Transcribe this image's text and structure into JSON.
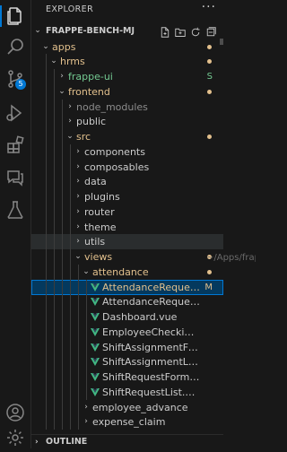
{
  "explorer": {
    "title": "EXPLORER",
    "more": "···",
    "workspace": "FRAPPE-BENCH-MJ",
    "tooltip_fragment": "~/Apps/frap"
  },
  "activity_bar": {
    "items": [
      {
        "name": "files",
        "active": true
      },
      {
        "name": "search"
      },
      {
        "name": "source-control",
        "badge": "5"
      },
      {
        "name": "run-debug"
      },
      {
        "name": "extensions"
      },
      {
        "name": "chat"
      },
      {
        "name": "testing"
      }
    ],
    "bottom": [
      "account",
      "manage"
    ]
  },
  "colors": {
    "folder_text": "#cccccc",
    "modified": "#e2c08d",
    "vue_green": "#41b883",
    "selection": "#04395e",
    "submodule": "#73c991"
  },
  "tree": [
    {
      "label": "apps",
      "depth": 1,
      "type": "folder",
      "open": true,
      "color": "#e2c08d",
      "dot": true
    },
    {
      "label": "hrms",
      "depth": 2,
      "type": "folder",
      "open": true,
      "color": "#e2c08d",
      "dot": true
    },
    {
      "label": "frappe-ui",
      "depth": 3,
      "type": "folder",
      "open": false,
      "color": "#73c991",
      "badge": "S"
    },
    {
      "label": "frontend",
      "depth": 3,
      "type": "folder",
      "open": true,
      "color": "#e2c08d",
      "dot": true
    },
    {
      "label": "node_modules",
      "depth": 4,
      "type": "folder",
      "open": false,
      "color": "#8c8c8c"
    },
    {
      "label": "public",
      "depth": 4,
      "type": "folder",
      "open": false,
      "color": "#cccccc"
    },
    {
      "label": "src",
      "depth": 4,
      "type": "folder",
      "open": true,
      "color": "#e2c08d",
      "dot": true
    },
    {
      "label": "components",
      "depth": 5,
      "type": "folder",
      "open": false,
      "color": "#cccccc"
    },
    {
      "label": "composables",
      "depth": 5,
      "type": "folder",
      "open": false,
      "color": "#cccccc"
    },
    {
      "label": "data",
      "depth": 5,
      "type": "folder",
      "open": false,
      "color": "#cccccc"
    },
    {
      "label": "plugins",
      "depth": 5,
      "type": "folder",
      "open": false,
      "color": "#cccccc"
    },
    {
      "label": "router",
      "depth": 5,
      "type": "folder",
      "open": false,
      "color": "#cccccc"
    },
    {
      "label": "theme",
      "depth": 5,
      "type": "folder",
      "open": false,
      "color": "#cccccc"
    },
    {
      "label": "utils",
      "depth": 5,
      "type": "folder",
      "open": false,
      "color": "#cccccc",
      "hovered": true
    },
    {
      "label": "views",
      "depth": 5,
      "type": "folder",
      "open": true,
      "color": "#e2c08d",
      "dot": true
    },
    {
      "label": "attendance",
      "depth": 6,
      "type": "folder",
      "open": true,
      "color": "#e2c08d",
      "dot": true
    },
    {
      "label": "AttendanceRequestForm....",
      "depth": 7,
      "type": "vue",
      "color": "#e2c08d",
      "badge": "M",
      "selected": true
    },
    {
      "label": "AttendanceRequestList.vue",
      "depth": 7,
      "type": "vue",
      "color": "#cccccc"
    },
    {
      "label": "Dashboard.vue",
      "depth": 7,
      "type": "vue",
      "color": "#cccccc"
    },
    {
      "label": "EmployeeCheckinList.vue",
      "depth": 7,
      "type": "vue",
      "color": "#cccccc"
    },
    {
      "label": "ShiftAssignmentForm.vue",
      "depth": 7,
      "type": "vue",
      "color": "#cccccc"
    },
    {
      "label": "ShiftAssignmentList.vue",
      "depth": 7,
      "type": "vue",
      "color": "#cccccc"
    },
    {
      "label": "ShiftRequestForm.vue",
      "depth": 7,
      "type": "vue",
      "color": "#cccccc"
    },
    {
      "label": "ShiftRequestList.vue",
      "depth": 7,
      "type": "vue",
      "color": "#cccccc"
    },
    {
      "label": "employee_advance",
      "depth": 6,
      "type": "folder",
      "open": false,
      "color": "#cccccc"
    },
    {
      "label": "expense_claim",
      "depth": 6,
      "type": "folder",
      "open": false,
      "color": "#cccccc"
    }
  ],
  "outline": {
    "label": "OUTLINE"
  }
}
